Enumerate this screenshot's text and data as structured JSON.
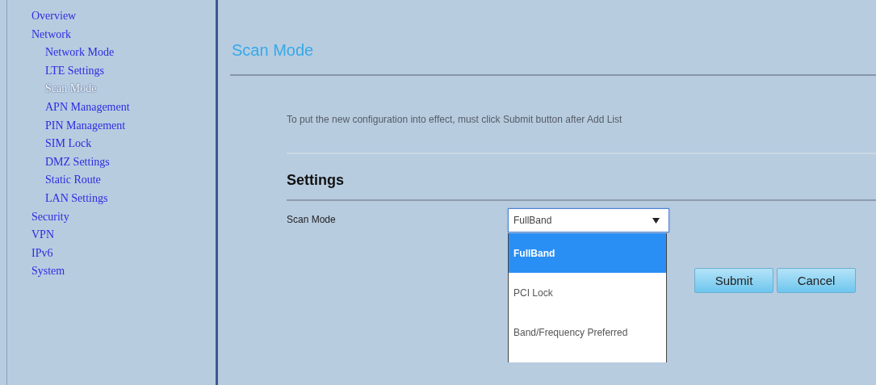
{
  "sidebar": {
    "items": [
      {
        "label": "Overview",
        "selected": false
      },
      {
        "label": "Network",
        "selected": false,
        "children": [
          {
            "label": "Network Mode",
            "selected": false
          },
          {
            "label": "LTE Settings",
            "selected": false
          },
          {
            "label": "Scan Mode",
            "selected": true
          },
          {
            "label": "APN Management",
            "selected": false
          },
          {
            "label": "PIN Management",
            "selected": false
          },
          {
            "label": "SIM Lock",
            "selected": false
          },
          {
            "label": "DMZ Settings",
            "selected": false
          },
          {
            "label": "Static Route",
            "selected": false
          },
          {
            "label": "LAN Settings",
            "selected": false
          }
        ]
      },
      {
        "label": "Security",
        "selected": false
      },
      {
        "label": "VPN",
        "selected": false
      },
      {
        "label": "IPv6",
        "selected": false
      },
      {
        "label": "System",
        "selected": false
      }
    ]
  },
  "page": {
    "title": "Scan Mode",
    "notice": "To put the new configuration into effect, must click Submit button after Add List"
  },
  "settings": {
    "heading": "Settings",
    "fields": [
      {
        "label": "Scan Mode",
        "value": "FullBand",
        "expanded": true,
        "options": [
          {
            "label": "FullBand",
            "selected": true
          },
          {
            "label": "PCI Lock",
            "selected": false
          },
          {
            "label": "Band/Frequency Preferred",
            "selected": false
          }
        ]
      }
    ]
  },
  "buttons": [
    "Submit",
    "Cancel"
  ]
}
